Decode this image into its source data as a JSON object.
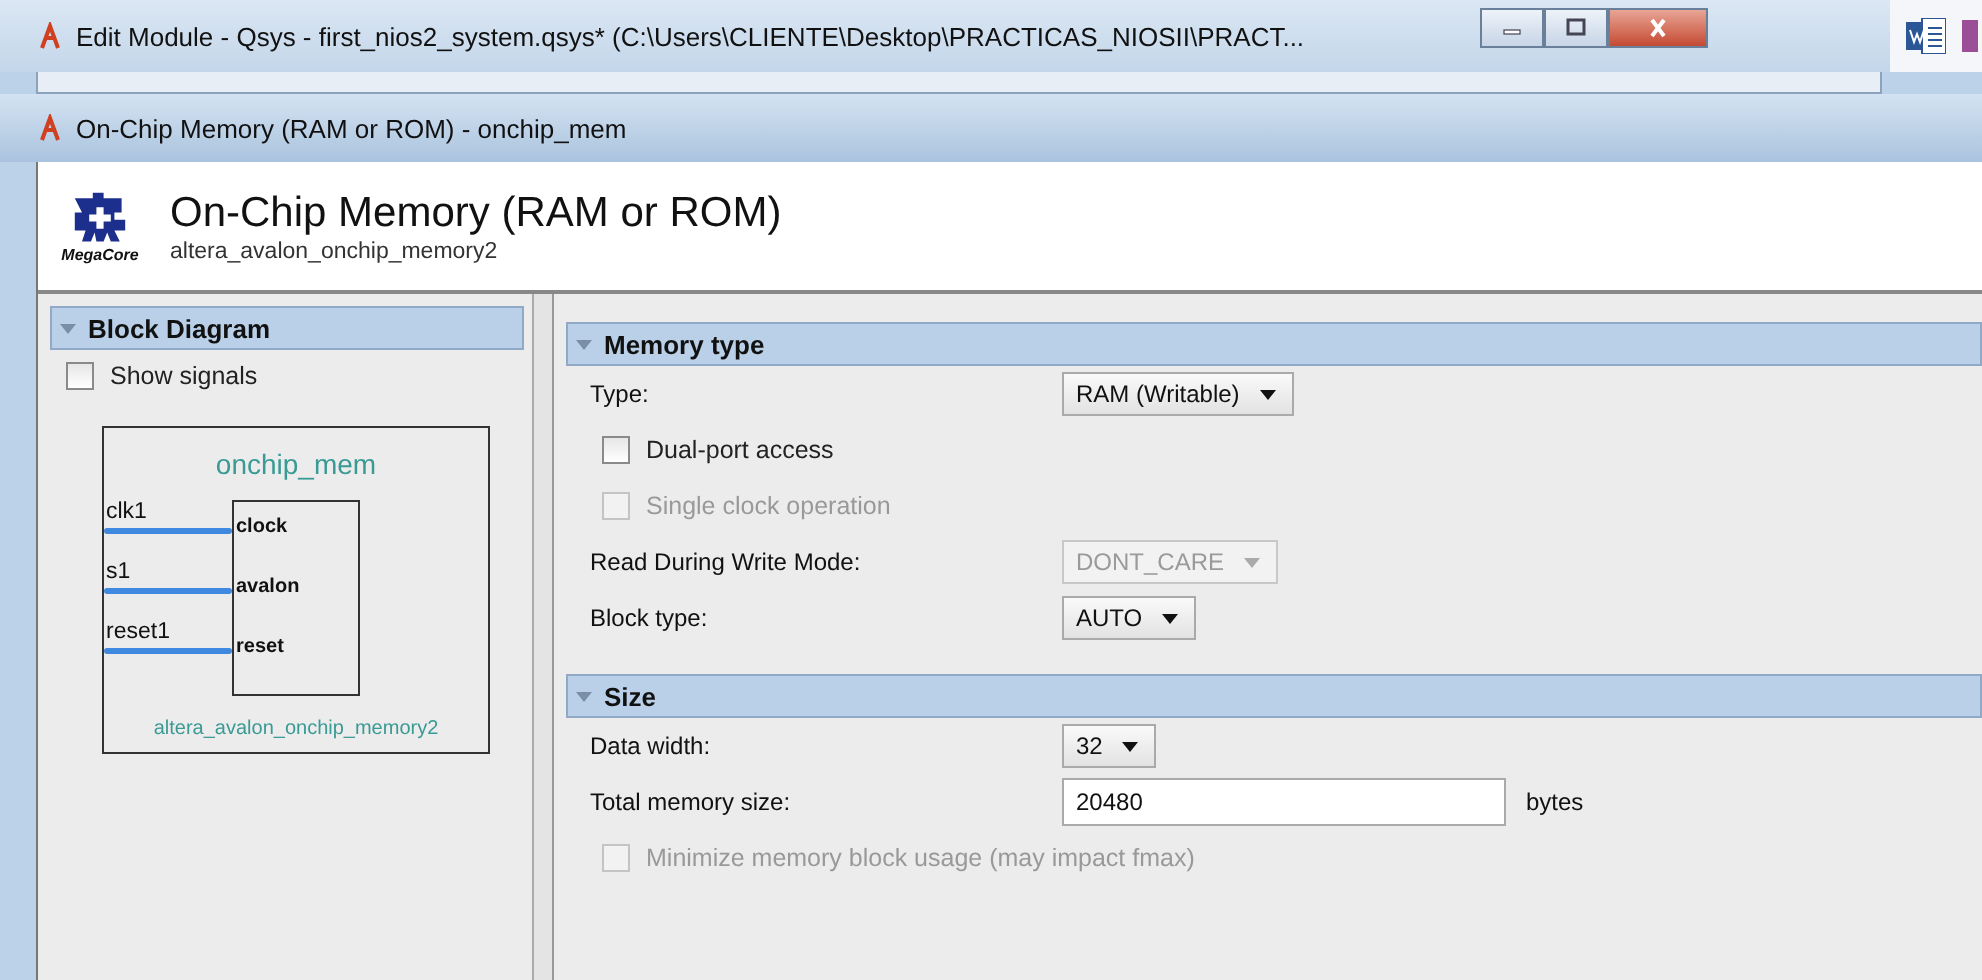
{
  "window": {
    "title": "Edit Module - Qsys - first_nios2_system.qsys* (C:\\Users\\CLIENTE\\Desktop\\PRACTICAS_NIOSII\\PRACT..."
  },
  "dialog": {
    "title": "On-Chip Memory (RAM or ROM) - onchip_mem"
  },
  "header": {
    "logo_text": "MegaCore",
    "title": "On-Chip Memory (RAM or ROM)",
    "subtitle": "altera_avalon_onchip_memory2"
  },
  "block_diagram": {
    "title": "Block Diagram",
    "expanded": true,
    "show_signals": {
      "label": "Show signals",
      "checked": false
    },
    "module": {
      "name": "onchip_mem",
      "type": "altera_avalon_onchip_memory2",
      "ports": [
        {
          "signal": "clk1",
          "port": "clock"
        },
        {
          "signal": "s1",
          "port": "avalon"
        },
        {
          "signal": "reset1",
          "port": "reset"
        }
      ]
    }
  },
  "sections": [
    {
      "title": "Memory type",
      "expanded": true,
      "fields": [
        {
          "kind": "select",
          "label": "Type:",
          "value": "RAM (Writable)",
          "disabled": false
        },
        {
          "kind": "checkbox",
          "label": "Dual-port access",
          "checked": false,
          "disabled": false
        },
        {
          "kind": "checkbox",
          "label": "Single clock operation",
          "checked": false,
          "disabled": true
        },
        {
          "kind": "select",
          "label": "Read During Write Mode:",
          "value": "DONT_CARE",
          "disabled": true
        },
        {
          "kind": "select",
          "label": "Block type:",
          "value": "AUTO",
          "disabled": false
        }
      ]
    },
    {
      "title": "Size",
      "expanded": true,
      "fields": [
        {
          "kind": "select",
          "label": "Data width:",
          "value": "32",
          "disabled": false
        },
        {
          "kind": "text",
          "label": "Total memory size:",
          "value": "20480",
          "unit": "bytes",
          "disabled": false
        },
        {
          "kind": "checkbox",
          "label": "Minimize memory block usage (may impact fmax)",
          "checked": false,
          "disabled": true
        }
      ]
    }
  ]
}
